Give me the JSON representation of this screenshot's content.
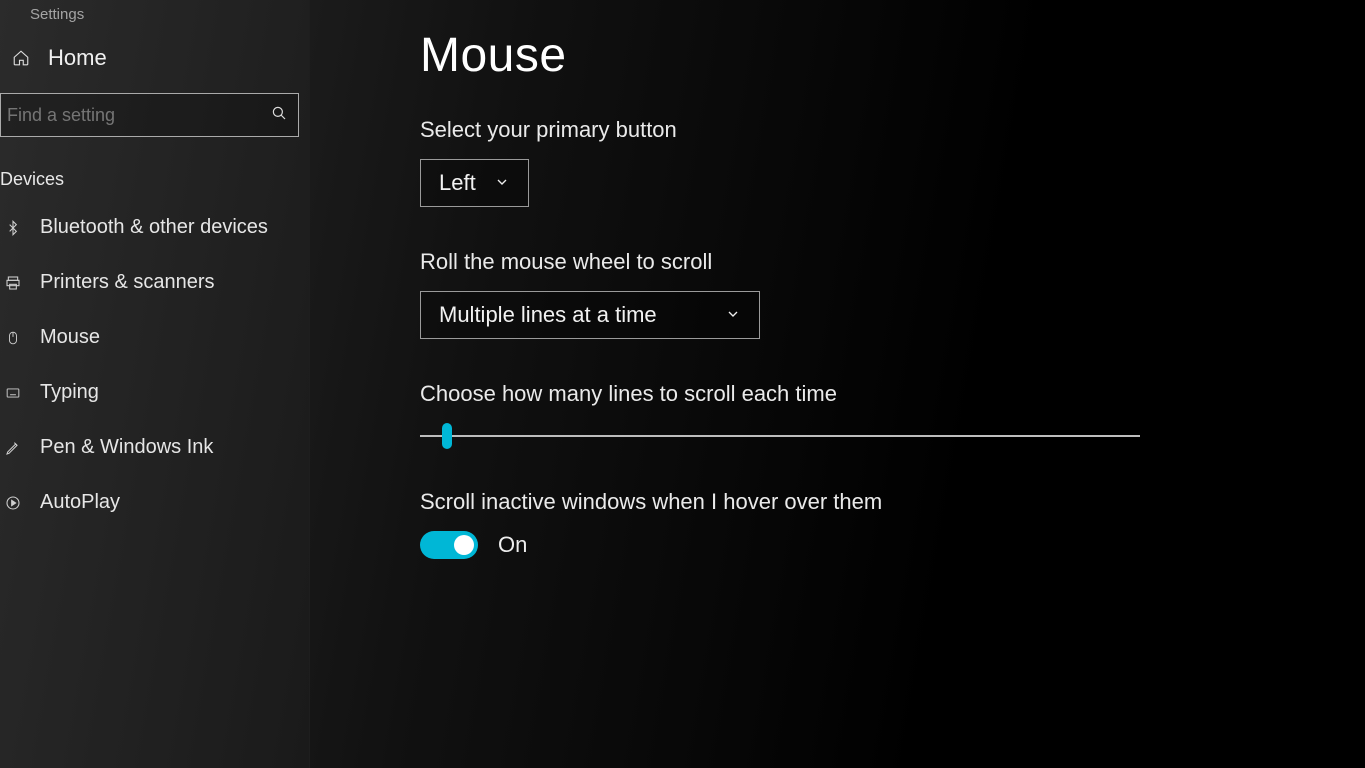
{
  "app_title": "Settings",
  "sidebar": {
    "home_label": "Home",
    "search_placeholder": "Find a setting",
    "category_label": "Devices",
    "items": [
      {
        "label": "Bluetooth & other devices",
        "icon": "bluetooth-icon"
      },
      {
        "label": "Printers & scanners",
        "icon": "printer-icon"
      },
      {
        "label": "Mouse",
        "icon": "mouse-icon"
      },
      {
        "label": "Typing",
        "icon": "keyboard-icon"
      },
      {
        "label": "Pen & Windows Ink",
        "icon": "pen-icon"
      },
      {
        "label": "AutoPlay",
        "icon": "autoplay-icon"
      }
    ]
  },
  "main": {
    "title": "Mouse",
    "primary_button": {
      "label": "Select your primary button",
      "value": "Left"
    },
    "wheel_scroll": {
      "label": "Roll the mouse wheel to scroll",
      "value": "Multiple lines at a time"
    },
    "lines_slider": {
      "label": "Choose how many lines to scroll each time",
      "position_percent": 3
    },
    "inactive_scroll": {
      "label": "Scroll inactive windows when I hover over them",
      "state_label": "On",
      "on": true
    }
  },
  "colors": {
    "accent": "#00b7d6"
  }
}
